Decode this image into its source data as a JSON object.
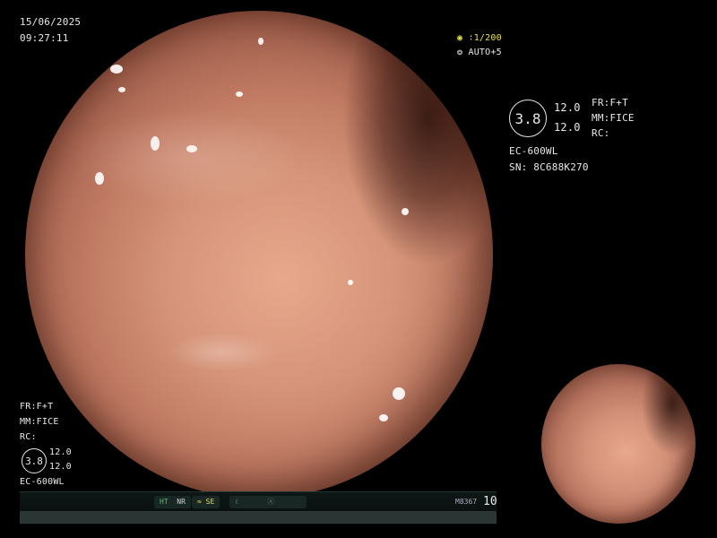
{
  "timestamp": {
    "date": "15/06/2025",
    "time": "09:27:11"
  },
  "shutter": {
    "icon": "shutter-icon",
    "value": "∶1/200",
    "color": "#e6e040"
  },
  "exposure": {
    "icon": "exposure-icon",
    "value": "AUTO+5"
  },
  "settings_right": {
    "scope_value": "3.8",
    "val1": "12.0",
    "val2": "12.0",
    "fr": "FR:F+T",
    "mm": "MM:FICE",
    "rc": "RC:",
    "model": "EC-600WL",
    "serial": "SN: 8C688K270"
  },
  "settings_left": {
    "fr": "FR:F+T",
    "mm": "MM:FICE",
    "rc": "RC:",
    "scope_value": "3.8",
    "val1": "12.0",
    "val2": "12.0",
    "model": "EC-600WL"
  },
  "status_bar": {
    "ht": "HT",
    "nr": "NR",
    "se": "SE",
    "code": "M8367",
    "count": "10"
  }
}
